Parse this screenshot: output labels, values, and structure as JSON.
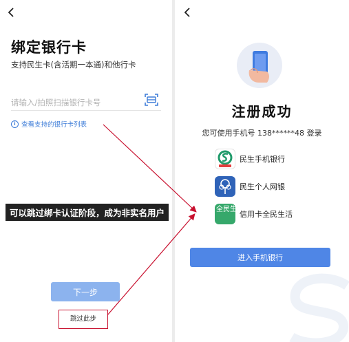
{
  "left_screen": {
    "title": "绑定银行卡",
    "subtitle": "支持民生卡(含活期一本通)和他行卡",
    "card_input": {
      "placeholder": "请输入/拍照扫描银行卡号",
      "value": ""
    },
    "supported_cards_link": "查看支持的银行卡列表",
    "next_button": "下一步",
    "skip_link": "跳过此步"
  },
  "annotation": {
    "text": "可以跳过绑卡认证阶段，成为非实名用户",
    "arrow_color": "#c8102e"
  },
  "right_screen": {
    "title": "注册成功",
    "login_hint": "您可使用手机号 138******48 登录",
    "apps": [
      {
        "label": "民生手机银行",
        "icon": "minsheng-mobile-bank-icon"
      },
      {
        "label": "民生个人网银",
        "icon": "minsheng-personal-ebank-icon"
      },
      {
        "label": "信用卡全民生活",
        "icon": "credit-card-quanmin-life-icon",
        "icon_text": "全民生活"
      }
    ],
    "enter_button": "进入手机银行"
  },
  "colors": {
    "primary_blue": "#4f86e6",
    "disabled_blue": "#8cb3ee",
    "link_blue": "#3d7cd8",
    "highlight_red": "#c8102e",
    "annotation_bg": "#222222"
  }
}
